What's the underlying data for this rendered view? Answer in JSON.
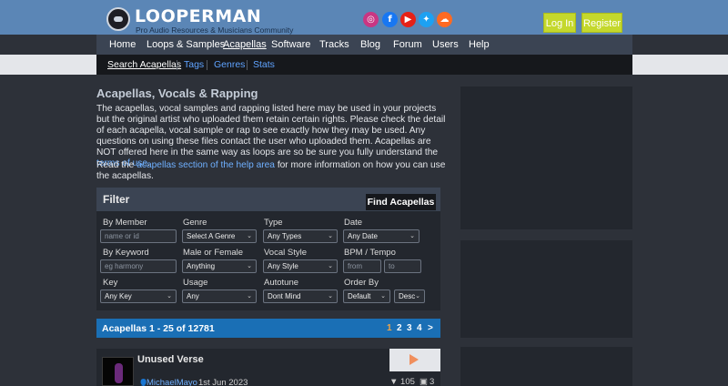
{
  "brand": {
    "name": "LOOPERMAN",
    "tagline": "Pro Audio Resources & Musicians Community"
  },
  "social_icons": [
    {
      "icon": "instagram-icon",
      "color": "#c93683",
      "glyph": "◎"
    },
    {
      "icon": "facebook-icon",
      "color": "#1877f2",
      "glyph": "f"
    },
    {
      "icon": "youtube-icon",
      "color": "#e62117",
      "glyph": "▶"
    },
    {
      "icon": "twitter-icon",
      "color": "#1da1f2",
      "glyph": "✦"
    },
    {
      "icon": "soundcloud-icon",
      "color": "#ff6a22",
      "glyph": "☁"
    }
  ],
  "auth": {
    "login": "Log In",
    "register": "Register"
  },
  "nav": [
    "Home",
    "Loops & Samples",
    "Acapellas",
    "Software",
    "Tracks",
    "Blog",
    "Forum",
    "Users",
    "Help"
  ],
  "nav_active": "Acapellas",
  "subnav": [
    "Search Acapellas",
    "Tags",
    "Genres",
    "Stats"
  ],
  "subnav_active": "Search Acapellas",
  "intro": {
    "title": "Acapellas, Vocals & Rapping",
    "p1_before": "The acapellas, vocal samples and rapping listed here may be used in your projects but the original artist who uploaded them retain certain rights. Please check the detail of each acapella, vocal sample or rap to see exactly how they may be used. Any questions on using these files contact the user who uploaded them. Acapellas are NOT offered here in the same way as loops are so be sure you fully understand the ",
    "p1_link": "terms of use",
    "p1_after": ".",
    "p2_before": "Read the ",
    "p2_link": "acapellas section of the help area",
    "p2_after": " for more information on how you can use the acapellas."
  },
  "filter": {
    "title": "Filter",
    "find_button": "Find Acapellas",
    "labels": {
      "member": "By Member",
      "genre": "Genre",
      "type": "Type",
      "date": "Date",
      "keyword": "By Keyword",
      "gender": "Male or Female",
      "vocal_style": "Vocal Style",
      "bpm": "BPM / Tempo",
      "key": "Key",
      "usage": "Usage",
      "autotune": "Autotune",
      "order_by": "Order By"
    },
    "fields": {
      "member_placeholder": "name or id",
      "genre": "Select A Genre",
      "type": "Any Types",
      "date": "Any Date",
      "keyword_placeholder": "eg harmony",
      "gender": "Anything",
      "vocal_style": "Any Style",
      "bpm_from": "from",
      "bpm_to": "to",
      "key": "Any Key",
      "usage": "Any",
      "autotune": "Dont Mind",
      "order_by": "Default",
      "order_dir": "Desc"
    }
  },
  "results": {
    "summary": "Acapellas 1 - 25 of 12781",
    "pages": [
      "1",
      "2",
      "3",
      "4",
      ">"
    ],
    "current_page": "1"
  },
  "track": {
    "title": "Unused Verse",
    "user": "MichaelMayo",
    "date": "1st Jun 2023",
    "downloads": "▼ 105",
    "comments": "3"
  }
}
